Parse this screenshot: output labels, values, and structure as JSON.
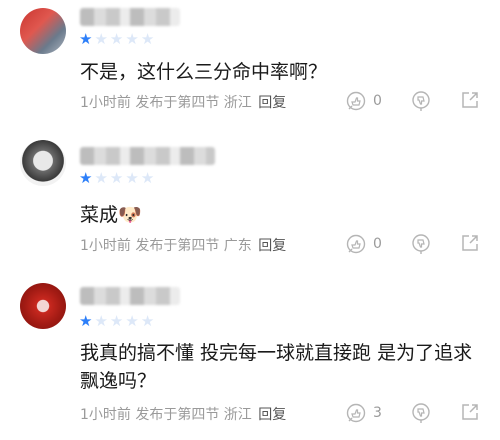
{
  "comments": [
    {
      "rating": 1,
      "text": "不是，这什么三分命中率啊？",
      "meta": "1小时前 发布于第四节 浙江",
      "reply_label": "回复",
      "like_count": "0"
    },
    {
      "rating": 1,
      "text": "菜成🐶",
      "meta": "1小时前 发布于第四节 广东",
      "reply_label": "回复",
      "like_count": "0"
    },
    {
      "rating": 1,
      "text": "我真的搞不懂 投完每一球就直接跑 是为了追求飘逸吗？",
      "meta": "1小时前 发布于第四节 浙江",
      "reply_label": "回复",
      "like_count": "3"
    }
  ],
  "icons": {
    "like": "thumb-up-circle-icon",
    "dislike": "thumb-down-circle-icon",
    "share": "share-icon"
  },
  "colors": {
    "star_on": "#2d7ff9",
    "star_off": "#dde8f8",
    "meta": "#9a9a9a"
  }
}
